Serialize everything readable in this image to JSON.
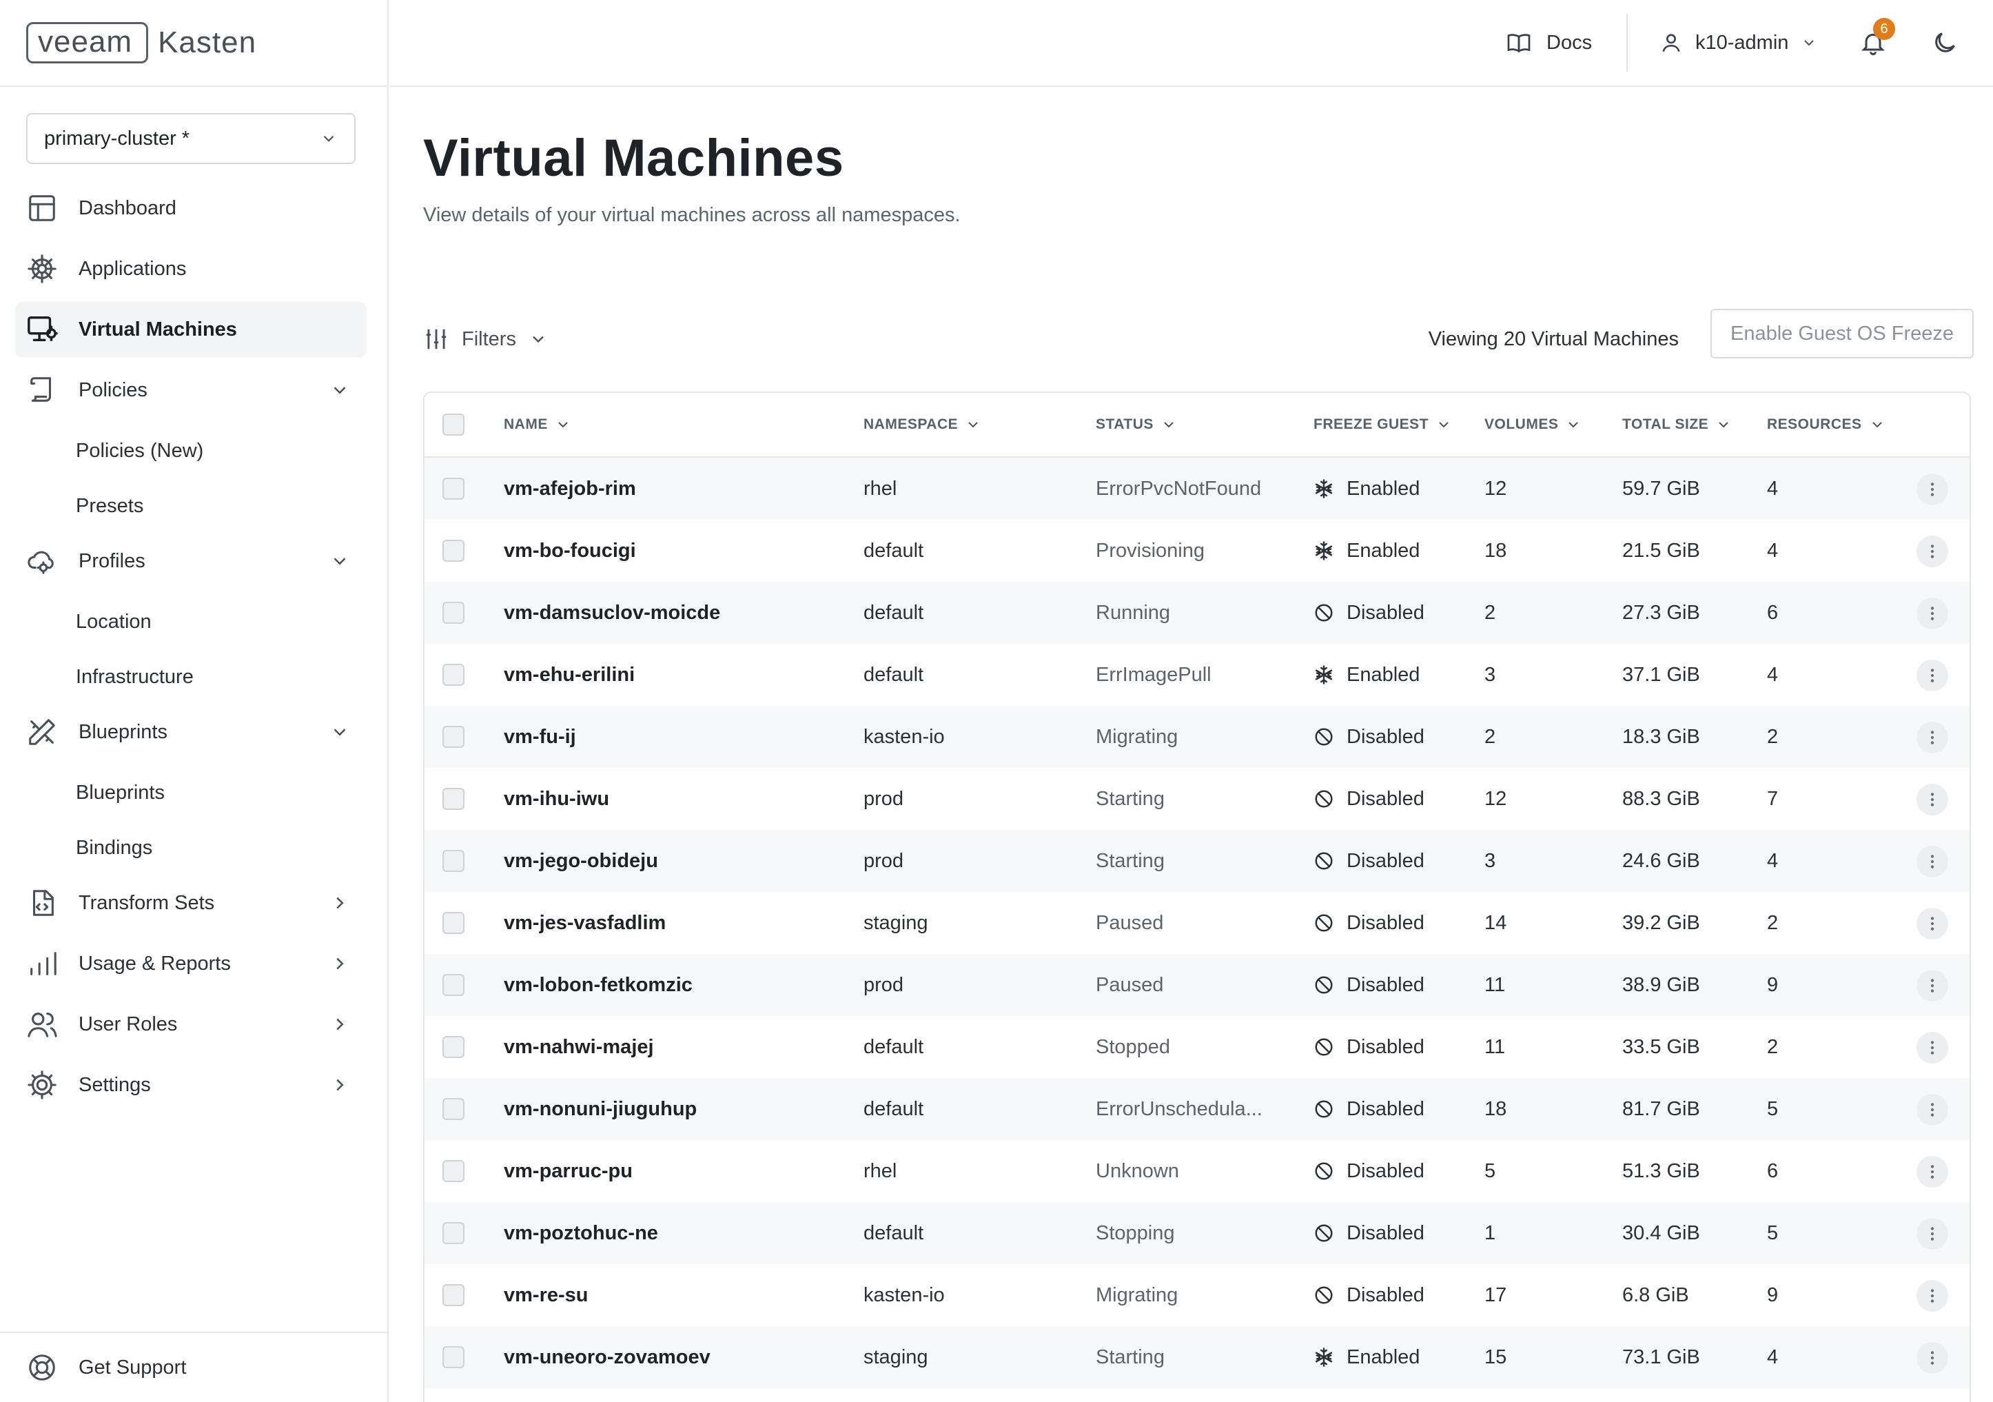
{
  "brand": {
    "logo_left": "veeam",
    "logo_right": "Kasten"
  },
  "cluster": {
    "selected": "primary-cluster *"
  },
  "sidebar": {
    "items": [
      {
        "label": "Dashboard",
        "icon": "dashboard-icon"
      },
      {
        "label": "Applications",
        "icon": "helm-icon"
      },
      {
        "label": "Virtual Machines",
        "icon": "monitor-icon",
        "active": true
      },
      {
        "label": "Policies",
        "icon": "scroll-icon",
        "expanded": true,
        "children": [
          "Policies (New)",
          "Presets"
        ]
      },
      {
        "label": "Profiles",
        "icon": "cloud-gear-icon",
        "expanded": true,
        "children": [
          "Location",
          "Infrastructure"
        ]
      },
      {
        "label": "Blueprints",
        "icon": "pencil-ruler-icon",
        "expanded": true,
        "children": [
          "Blueprints",
          "Bindings"
        ]
      },
      {
        "label": "Transform Sets",
        "icon": "file-code-icon"
      },
      {
        "label": "Usage & Reports",
        "icon": "bar-chart-icon"
      },
      {
        "label": "User Roles",
        "icon": "users-icon"
      },
      {
        "label": "Settings",
        "icon": "gear-icon"
      }
    ],
    "support_label": "Get Support"
  },
  "topbar": {
    "docs_label": "Docs",
    "user_label": "k10-admin",
    "notification_count": "6"
  },
  "page": {
    "title": "Virtual Machines",
    "subtitle": "View details of your virtual machines across all namespaces.",
    "filters_label": "Filters",
    "viewing_text": "Viewing 20 Virtual Machines",
    "guest_freeze_button": "Enable Guest OS Freeze"
  },
  "table": {
    "columns": [
      "NAME",
      "NAMESPACE",
      "STATUS",
      "FREEZE GUEST",
      "VOLUMES",
      "TOTAL SIZE",
      "RESOURCES"
    ],
    "rows": [
      {
        "name": "vm-afejob-rim",
        "namespace": "rhel",
        "status": "ErrorPvcNotFound",
        "freeze": "Enabled",
        "volumes": "12",
        "size": "59.7 GiB",
        "resources": "4"
      },
      {
        "name": "vm-bo-foucigi",
        "namespace": "default",
        "status": "Provisioning",
        "freeze": "Enabled",
        "volumes": "18",
        "size": "21.5 GiB",
        "resources": "4"
      },
      {
        "name": "vm-damsuclov-moicde",
        "namespace": "default",
        "status": "Running",
        "freeze": "Disabled",
        "volumes": "2",
        "size": "27.3 GiB",
        "resources": "6"
      },
      {
        "name": "vm-ehu-erilini",
        "namespace": "default",
        "status": "ErrImagePull",
        "freeze": "Enabled",
        "volumes": "3",
        "size": "37.1 GiB",
        "resources": "4"
      },
      {
        "name": "vm-fu-ij",
        "namespace": "kasten-io",
        "status": "Migrating",
        "freeze": "Disabled",
        "volumes": "2",
        "size": "18.3 GiB",
        "resources": "2"
      },
      {
        "name": "vm-ihu-iwu",
        "namespace": "prod",
        "status": "Starting",
        "freeze": "Disabled",
        "volumes": "12",
        "size": "88.3 GiB",
        "resources": "7"
      },
      {
        "name": "vm-jego-obideju",
        "namespace": "prod",
        "status": "Starting",
        "freeze": "Disabled",
        "volumes": "3",
        "size": "24.6 GiB",
        "resources": "4"
      },
      {
        "name": "vm-jes-vasfadlim",
        "namespace": "staging",
        "status": "Paused",
        "freeze": "Disabled",
        "volumes": "14",
        "size": "39.2 GiB",
        "resources": "2"
      },
      {
        "name": "vm-lobon-fetkomzic",
        "namespace": "prod",
        "status": "Paused",
        "freeze": "Disabled",
        "volumes": "11",
        "size": "38.9 GiB",
        "resources": "9"
      },
      {
        "name": "vm-nahwi-majej",
        "namespace": "default",
        "status": "Stopped",
        "freeze": "Disabled",
        "volumes": "11",
        "size": "33.5 GiB",
        "resources": "2"
      },
      {
        "name": "vm-nonuni-jiuguhup",
        "namespace": "default",
        "status": "ErrorUnschedula...",
        "freeze": "Disabled",
        "volumes": "18",
        "size": "81.7 GiB",
        "resources": "5"
      },
      {
        "name": "vm-parruc-pu",
        "namespace": "rhel",
        "status": "Unknown",
        "freeze": "Disabled",
        "volumes": "5",
        "size": "51.3 GiB",
        "resources": "6"
      },
      {
        "name": "vm-poztohuc-ne",
        "namespace": "default",
        "status": "Stopping",
        "freeze": "Disabled",
        "volumes": "1",
        "size": "30.4 GiB",
        "resources": "5"
      },
      {
        "name": "vm-re-su",
        "namespace": "kasten-io",
        "status": "Migrating",
        "freeze": "Disabled",
        "volumes": "17",
        "size": "6.8 GiB",
        "resources": "9"
      },
      {
        "name": "vm-uneoro-zovamoev",
        "namespace": "staging",
        "status": "Starting",
        "freeze": "Enabled",
        "volumes": "15",
        "size": "73.1 GiB",
        "resources": "4"
      }
    ]
  },
  "colors": {
    "accent_badge": "#e07d1a",
    "active_nav_bg": "#f3f4f6",
    "alt_row_bg": "#f7f8f9"
  }
}
